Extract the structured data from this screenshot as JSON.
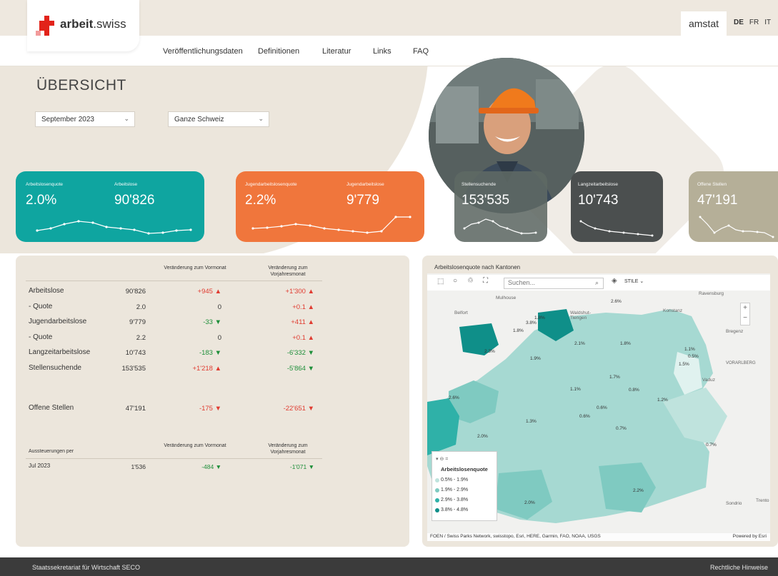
{
  "header": {
    "logo_text_bold": "arbeit",
    "logo_text_light": ".swiss",
    "amstat": "amstat",
    "languages": [
      "DE",
      "FR",
      "IT"
    ]
  },
  "nav": [
    "Veröffentlichungsdaten",
    "Definitionen",
    "Literatur",
    "Links",
    "FAQ"
  ],
  "page": {
    "title": "ÜBERSICHT",
    "month_select": "September 2023",
    "region_select": "Ganze Schweiz"
  },
  "cards": [
    {
      "label": "Arbeitslosenquote",
      "value": "2.0%",
      "color": "#0fa5a0"
    },
    {
      "label": "Arbeitslose",
      "value": "90'826",
      "color": "#0fa5a0"
    },
    {
      "label": "Jugendarbeitslosenquote",
      "value": "2.2%",
      "color": "#f0763c"
    },
    {
      "label": "Jugendarbeitslose",
      "value": "9'779",
      "color": "#f0763c"
    },
    {
      "label": "Stellensuchende",
      "value": "153'535",
      "color": "#6b7570"
    },
    {
      "label": "Langzeitarbeitslose",
      "value": "10'743",
      "color": "#4b4f4f"
    },
    {
      "label": "Offene Stellen",
      "value": "47'191",
      "color": "#b5af98"
    }
  ],
  "table": {
    "col_month": "Veränderung zum Vormonat",
    "col_year": "Veränderung zum Vorjahresmonat",
    "rows": [
      {
        "label": "Arbeitslose",
        "value": "90'826",
        "mom": "+945 ▲",
        "yoy": "+1'300 ▲",
        "mom_color": "red",
        "yoy_color": "red"
      },
      {
        "label": "- Quote",
        "value": "2.0",
        "mom": "0",
        "yoy": "+0.1 ▲",
        "mom_color": "neutral",
        "yoy_color": "red"
      },
      {
        "label": "Jugendarbeitslose",
        "value": "9'779",
        "mom": "-33 ▼",
        "yoy": "+411 ▲",
        "mom_color": "green",
        "yoy_color": "red"
      },
      {
        "label": "- Quote",
        "value": "2.2",
        "mom": "0",
        "yoy": "+0.1 ▲",
        "mom_color": "neutral",
        "yoy_color": "red"
      },
      {
        "label": "Langzeitarbeitslose",
        "value": "10'743",
        "mom": "-183 ▼",
        "yoy": "-6'332 ▼",
        "mom_color": "green",
        "yoy_color": "green"
      },
      {
        "label": "Stellensuchende",
        "value": "153'535",
        "mom": "+1'218 ▲",
        "yoy": "-5'864 ▼",
        "mom_color": "red",
        "yoy_color": "green"
      }
    ],
    "open": {
      "label": "Offene Stellen",
      "value": "47'191",
      "mom": "-175 ▼",
      "yoy": "-22'651 ▼"
    },
    "aussteuerung_label": "Aussteuerungen per",
    "aussteuerung": {
      "label": "Jul 2023",
      "value": "1'536",
      "mom": "-484 ▼",
      "yoy": "-1'071 ▼"
    }
  },
  "map": {
    "title": "Arbeitslosenquote nach Kantonen",
    "search_placeholder": "Suchen...",
    "stile": "STILE",
    "legend_title": "Arbeitslosenquote",
    "legend": [
      {
        "label": "0.5% - 1.9%",
        "color": "#bfe3dd"
      },
      {
        "label": "1.9% - 2.9%",
        "color": "#7fcac1"
      },
      {
        "label": "2.9% - 3.8%",
        "color": "#2fb1a8"
      },
      {
        "label": "3.8% - 4.8%",
        "color": "#0f8f89"
      }
    ],
    "cities": [
      "Mulhouse",
      "Belfort",
      "Waldshut-Tiengen",
      "Ravensburg",
      "Konstanz",
      "Bregenz",
      "VORARLBERG",
      "Vaduz",
      "Sondrio",
      "Trento"
    ],
    "labels": [
      "2.6%",
      "1.8%",
      "3.8%",
      "1.8%",
      "2.1%",
      "1.8%",
      "1.9%",
      "2.3%",
      "1.1%",
      "0.5%",
      "1.5%",
      "1.7%",
      "0.8%",
      "1.1%",
      "1.2%",
      "2.6%",
      "0.6%",
      "0.6%",
      "1.3%",
      "0.7%",
      "2.0%",
      "0.7%",
      "2.2%",
      "2.0%"
    ],
    "attribution": "FOEN / Swiss Parks Network, swisstopo, Esri, HERE, Garmin, FAO, NOAA, USGS",
    "powered": "Powered by Esri"
  },
  "footer": {
    "left": "Staatssekretariat für Wirtschaft SECO",
    "right": "Rechtliche Hinweise"
  }
}
